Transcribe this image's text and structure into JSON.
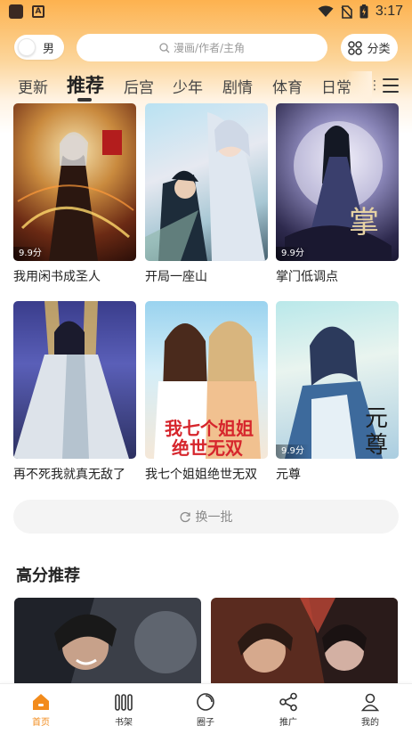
{
  "status_bar": {
    "time": "3:17"
  },
  "header": {
    "gender_label": "男",
    "search_placeholder": "漫画/作者/主角",
    "category_label": "分类"
  },
  "tabs": [
    {
      "label": "更新"
    },
    {
      "label": "推荐",
      "active": true
    },
    {
      "label": "后宫"
    },
    {
      "label": "少年"
    },
    {
      "label": "剧情"
    },
    {
      "label": "体育"
    },
    {
      "label": "日常"
    }
  ],
  "comics": [
    {
      "title": "我用闲书成圣人",
      "score": "9.9分"
    },
    {
      "title": "开局一座山",
      "score": ""
    },
    {
      "title": "掌门低调点",
      "score": "9.9分"
    },
    {
      "title": "再不死我就真无敌了",
      "score": ""
    },
    {
      "title": "我七个姐姐绝世无双",
      "score": ""
    },
    {
      "title": "元尊",
      "score": "9.9分"
    }
  ],
  "refresh_label": "换一批",
  "high_score_section": {
    "title": "高分推荐"
  },
  "bottom_nav": [
    {
      "label": "首页",
      "icon": "home-icon",
      "active": true
    },
    {
      "label": "书架",
      "icon": "bookshelf-icon"
    },
    {
      "label": "圈子",
      "icon": "circle-icon"
    },
    {
      "label": "推广",
      "icon": "share-icon"
    },
    {
      "label": "我的",
      "icon": "profile-icon"
    }
  ],
  "colors": {
    "accent": "#f28b1c",
    "header_top": "#fdb24f"
  }
}
